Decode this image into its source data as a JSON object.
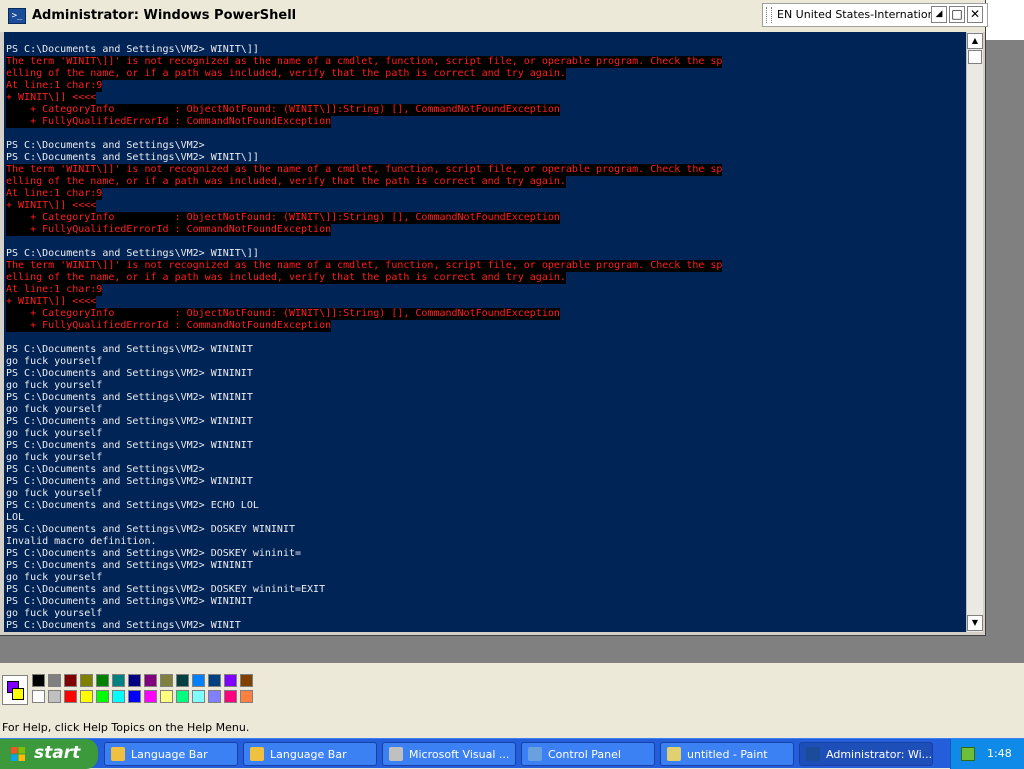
{
  "window": {
    "title": "Administrator: Windows PowerShell"
  },
  "language_bar": {
    "text": "EN United States-International"
  },
  "console_lines": [
    {
      "text": "PS C:\\Documents and Settings\\VM2> WINIT\\]]",
      "type": "normal"
    },
    {
      "text": "The term 'WINIT\\]]' is not recognized as the name of a cmdlet, function, script file, or operable program. Check the sp",
      "type": "error"
    },
    {
      "text": "elling of the name, or if a path was included, verify that the path is correct and try again.",
      "type": "error"
    },
    {
      "text": "At line:1 char:9",
      "type": "error"
    },
    {
      "text": "+ WINIT\\]] <<<<",
      "type": "error"
    },
    {
      "text": "    + CategoryInfo          : ObjectNotFound: (WINIT\\]]:String) [], CommandNotFoundException",
      "type": "error"
    },
    {
      "text": "    + FullyQualifiedErrorId : CommandNotFoundException",
      "type": "error"
    },
    {
      "text": "",
      "type": "normal"
    },
    {
      "text": "PS C:\\Documents and Settings\\VM2>",
      "type": "normal"
    },
    {
      "text": "PS C:\\Documents and Settings\\VM2> WINIT\\]]",
      "type": "normal"
    },
    {
      "text": "The term 'WINIT\\]]' is not recognized as the name of a cmdlet, function, script file, or operable program. Check the sp",
      "type": "error"
    },
    {
      "text": "elling of the name, or if a path was included, verify that the path is correct and try again.",
      "type": "error"
    },
    {
      "text": "At line:1 char:9",
      "type": "error"
    },
    {
      "text": "+ WINIT\\]] <<<<",
      "type": "error"
    },
    {
      "text": "    + CategoryInfo          : ObjectNotFound: (WINIT\\]]:String) [], CommandNotFoundException",
      "type": "error"
    },
    {
      "text": "    + FullyQualifiedErrorId : CommandNotFoundException",
      "type": "error"
    },
    {
      "text": "",
      "type": "normal"
    },
    {
      "text": "PS C:\\Documents and Settings\\VM2> WINIT\\]]",
      "type": "normal"
    },
    {
      "text": "The term 'WINIT\\]]' is not recognized as the name of a cmdlet, function, script file, or operable program. Check the sp",
      "type": "error"
    },
    {
      "text": "elling of the name, or if a path was included, verify that the path is correct and try again.",
      "type": "error"
    },
    {
      "text": "At line:1 char:9",
      "type": "error"
    },
    {
      "text": "+ WINIT\\]] <<<<",
      "type": "error"
    },
    {
      "text": "    + CategoryInfo          : ObjectNotFound: (WINIT\\]]:String) [], CommandNotFoundException",
      "type": "error"
    },
    {
      "text": "    + FullyQualifiedErrorId : CommandNotFoundException",
      "type": "error"
    },
    {
      "text": "",
      "type": "normal"
    },
    {
      "text": "PS C:\\Documents and Settings\\VM2> WININIT",
      "type": "normal"
    },
    {
      "text": "go fuck yourself",
      "type": "normal"
    },
    {
      "text": "PS C:\\Documents and Settings\\VM2> WININIT",
      "type": "normal"
    },
    {
      "text": "go fuck yourself",
      "type": "normal"
    },
    {
      "text": "PS C:\\Documents and Settings\\VM2> WININIT",
      "type": "normal"
    },
    {
      "text": "go fuck yourself",
      "type": "normal"
    },
    {
      "text": "PS C:\\Documents and Settings\\VM2> WININIT",
      "type": "normal"
    },
    {
      "text": "go fuck yourself",
      "type": "normal"
    },
    {
      "text": "PS C:\\Documents and Settings\\VM2> WININIT",
      "type": "normal"
    },
    {
      "text": "go fuck yourself",
      "type": "normal"
    },
    {
      "text": "PS C:\\Documents and Settings\\VM2>",
      "type": "normal"
    },
    {
      "text": "PS C:\\Documents and Settings\\VM2> WININIT",
      "type": "normal"
    },
    {
      "text": "go fuck yourself",
      "type": "normal"
    },
    {
      "text": "PS C:\\Documents and Settings\\VM2> ECHO LOL",
      "type": "normal"
    },
    {
      "text": "LOL",
      "type": "normal"
    },
    {
      "text": "PS C:\\Documents and Settings\\VM2> DOSKEY WININIT",
      "type": "normal"
    },
    {
      "text": "Invalid macro definition.",
      "type": "normal"
    },
    {
      "text": "PS C:\\Documents and Settings\\VM2> DOSKEY wininit=",
      "type": "normal"
    },
    {
      "text": "PS C:\\Documents and Settings\\VM2> WININIT",
      "type": "normal"
    },
    {
      "text": "go fuck yourself",
      "type": "normal"
    },
    {
      "text": "PS C:\\Documents and Settings\\VM2> DOSKEY wininit=EXIT",
      "type": "normal"
    },
    {
      "text": "PS C:\\Documents and Settings\\VM2> WININIT",
      "type": "normal"
    },
    {
      "text": "go fuck yourself",
      "type": "normal"
    },
    {
      "text": "PS C:\\Documents and Settings\\VM2> WINIT",
      "type": "normal"
    }
  ],
  "paint": {
    "status_text": "For Help, click Help Topics on the Help Menu.",
    "palette_top": [
      "#000000",
      "#808080",
      "#800000",
      "#808000",
      "#008000",
      "#008080",
      "#000080",
      "#800080",
      "#808040",
      "#004040",
      "#0080ff",
      "#004080",
      "#8000ff",
      "#804000"
    ],
    "palette_bottom": [
      "#ffffff",
      "#c0c0c0",
      "#ff0000",
      "#ffff00",
      "#00ff00",
      "#00ffff",
      "#0000ff",
      "#ff00ff",
      "#ffff80",
      "#00ff80",
      "#80ffff",
      "#8080ff",
      "#ff0080",
      "#ff8040"
    ]
  },
  "taskbar": {
    "start_label": "start",
    "clock": "1:48",
    "items": [
      {
        "label": "Language Bar",
        "icon": "language-bar-icon",
        "icon_color": "#f0c040",
        "active": false
      },
      {
        "label": "Language Bar",
        "icon": "language-bar-icon",
        "icon_color": "#f0c040",
        "active": false
      },
      {
        "label": "Microsoft Visual ...",
        "icon": "visual-studio-icon",
        "icon_color": "#c0c0c0",
        "active": false
      },
      {
        "label": "Control Panel",
        "icon": "control-panel-icon",
        "icon_color": "#6aa0e0",
        "active": false
      },
      {
        "label": "untitled - Paint",
        "icon": "paint-icon",
        "icon_color": "#e0d070",
        "active": false
      },
      {
        "label": "Administrator: Wi...",
        "icon": "powershell-icon",
        "icon_color": "#1b4c9a",
        "active": true
      }
    ]
  },
  "colors": {
    "console_bg": "#012456",
    "console_fg": "#eeedf0",
    "error_fg": "#ff1e1e",
    "taskbar_bg": "#245edb",
    "start_green": "#3c9a3c"
  }
}
